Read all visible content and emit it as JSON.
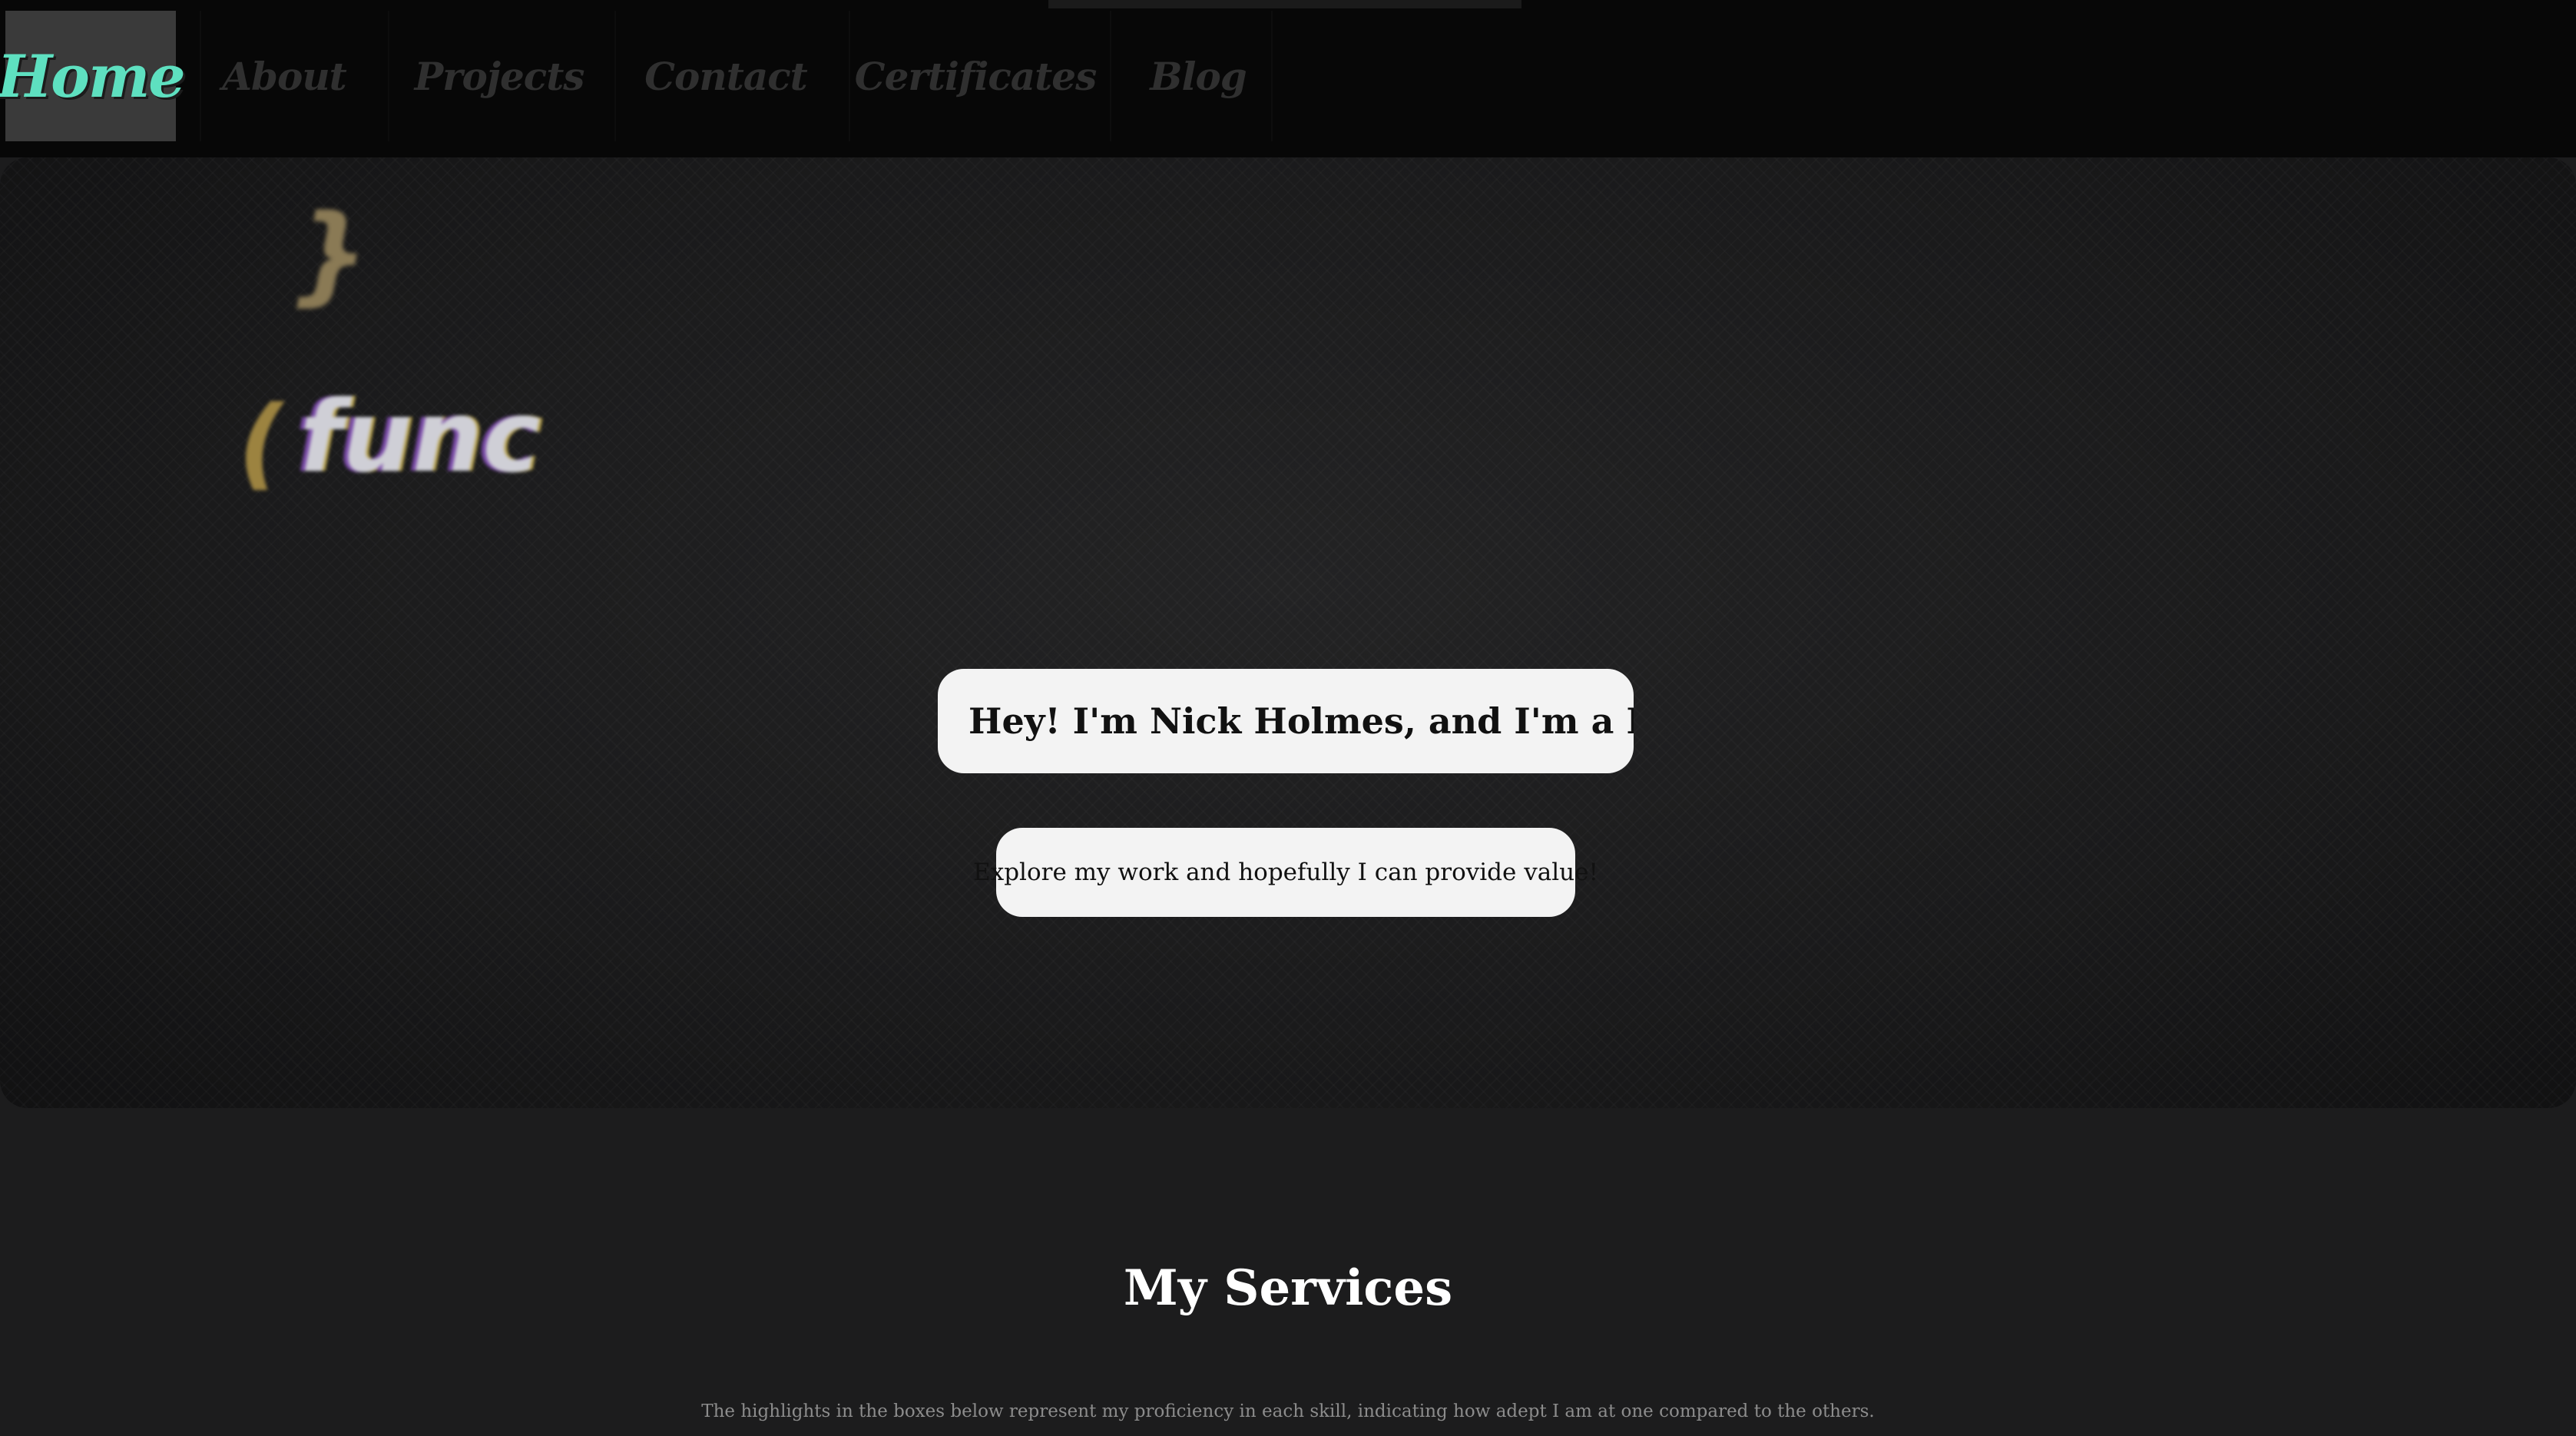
{
  "nav": {
    "items": [
      {
        "label": "Home",
        "active": true
      },
      {
        "label": "About",
        "active": false
      },
      {
        "label": "Projects",
        "active": false
      },
      {
        "label": "Contact",
        "active": false
      },
      {
        "label": "Certificates",
        "active": false
      },
      {
        "label": "Blog",
        "active": false
      }
    ]
  },
  "hero": {
    "background_code": {
      "brace": "}",
      "paren": "(",
      "func": "func"
    },
    "heading": "Hey! I'm Nick Holmes, and I'm a Full S",
    "subheading": "Explore my work and hopefully I can provide value!"
  },
  "services": {
    "title": "My Services",
    "description": "The highlights in the boxes below represent my proficiency in each skill, indicating how adept I am at one compared to the others."
  },
  "colors": {
    "nav_active_text": "#5ee0c0",
    "nav_inactive_text": "#2f2f2f",
    "nav_background": "#070707",
    "page_background": "#1c1c1d",
    "bubble_background": "#f3f3f3"
  }
}
